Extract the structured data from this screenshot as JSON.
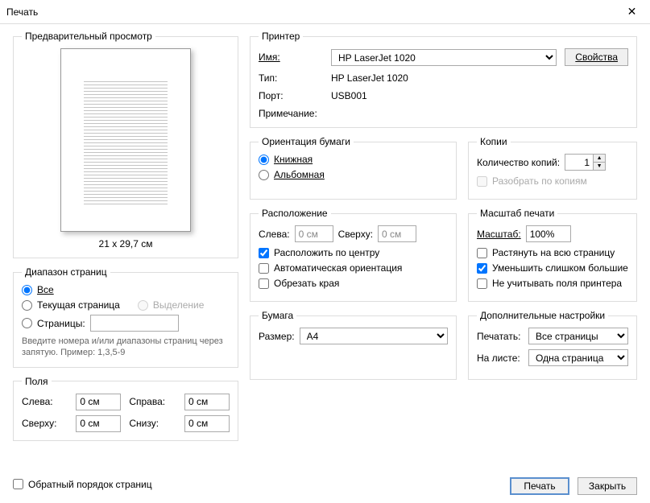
{
  "window": {
    "title": "Печать"
  },
  "preview": {
    "legend": "Предварительный просмотр",
    "dimensions": "21 x 29,7 см"
  },
  "printer": {
    "legend": "Принтер",
    "name_label": "Имя:",
    "name_value": "HP LaserJet 1020",
    "properties_btn": "Свойства",
    "type_label": "Тип:",
    "type_value": "HP LaserJet 1020",
    "port_label": "Порт:",
    "port_value": "USB001",
    "note_label": "Примечание:"
  },
  "range": {
    "legend": "Диапазон страниц",
    "all": "Все",
    "current": "Текущая страница",
    "selection": "Выделение",
    "pages": "Страницы:",
    "hint": "Введите номера и/или диапазоны страниц через запятую. Пример: 1,3,5-9"
  },
  "orientation": {
    "legend": "Ориентация бумаги",
    "portrait": "Книжная",
    "landscape": "Альбомная"
  },
  "copies": {
    "legend": "Копии",
    "count_label": "Количество копий:",
    "count_value": "1",
    "collate": "Разобрать по копиям"
  },
  "position": {
    "legend": "Расположение",
    "left_label": "Слева:",
    "left_value": "0 см",
    "top_label": "Сверху:",
    "top_value": "0 см",
    "center": "Расположить по центру",
    "auto_orient": "Автоматическая ориентация",
    "crop": "Обрезать края"
  },
  "scale": {
    "legend": "Масштаб печати",
    "label": "Масштаб:",
    "value": "100%",
    "stretch": "Растянуть на всю страницу",
    "shrink": "Уменьшить слишком большие",
    "ignore_margins": "Не учитывать поля принтера"
  },
  "margins": {
    "legend": "Поля",
    "left": "Слева:",
    "right": "Справа:",
    "top": "Сверху:",
    "bottom": "Снизу:",
    "val": "0 см"
  },
  "paper": {
    "legend": "Бумага",
    "size_label": "Размер:",
    "size_value": "A4"
  },
  "extra": {
    "legend": "Дополнительные настройки",
    "print_label": "Печатать:",
    "print_value": "Все страницы",
    "persheet_label": "На листе:",
    "persheet_value": "Одна страница"
  },
  "footer": {
    "reverse": "Обратный порядок страниц",
    "print_btn": "Печать",
    "close_btn": "Закрыть"
  }
}
